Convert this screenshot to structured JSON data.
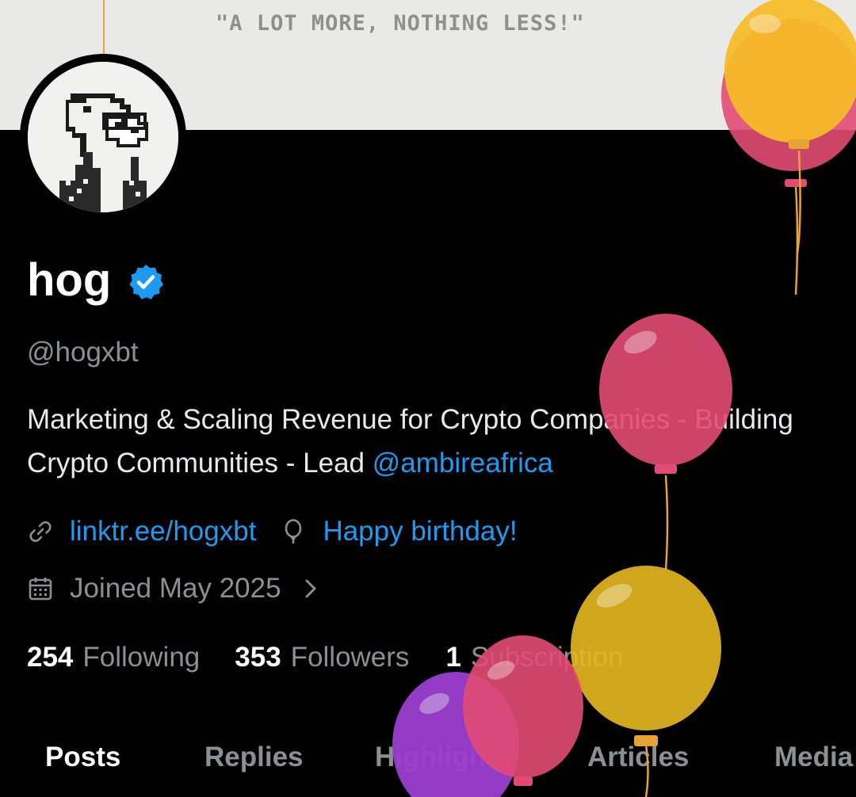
{
  "banner": {
    "tagline": "\"A  LOT MORE, NOTHING  LESS!\""
  },
  "profile": {
    "display_name": "hog",
    "handle": "@hogxbt",
    "bio_main": "Marketing & Scaling Revenue for Crypto Companies - Building Crypto Communities - Lead ",
    "bio_mention": "@ambireafrica",
    "link": "linktr.ee/hogxbt",
    "birthday": "Happy birthday!",
    "joined": "Joined May 2025"
  },
  "stats": {
    "following_count": "254",
    "following_label": "Following",
    "followers_count": "353",
    "followers_label": "Followers",
    "subscriptions_count": "1",
    "subscriptions_label": "Subscription"
  },
  "tabs": [
    "Posts",
    "Replies",
    "Highlights",
    "Articles",
    "Media"
  ],
  "icons": {
    "verified": "verified-badge-icon",
    "link": "link-icon",
    "birthday": "balloon-icon",
    "joined": "calendar-icon",
    "chevron": "chevron-right-icon"
  },
  "colors": {
    "background": "#000000",
    "accent_blue": "#1d9bf0",
    "muted_text": "#8b9095",
    "primary_text": "#e7e9ea"
  }
}
